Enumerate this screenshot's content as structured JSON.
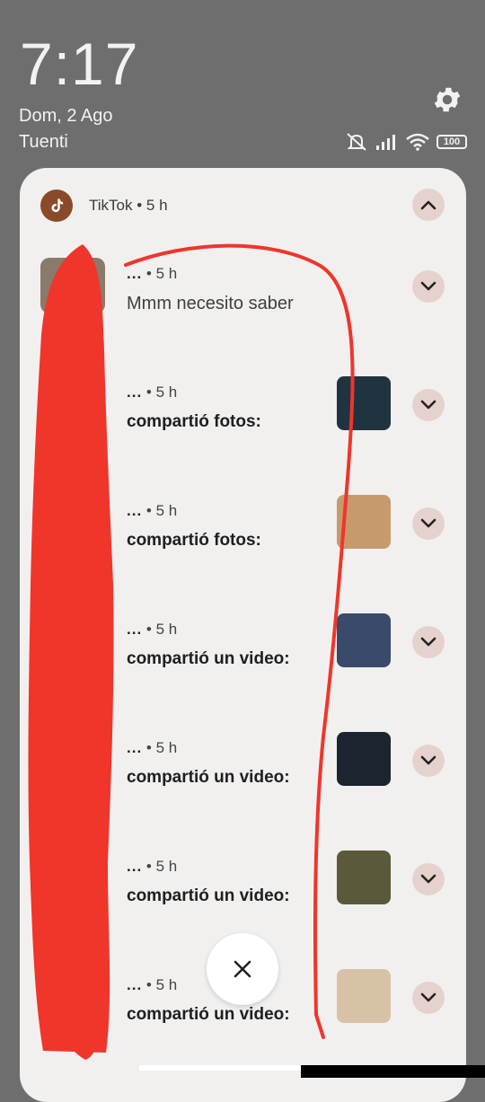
{
  "status_bar": {
    "time": "7:17",
    "date": "Dom, 2 Ago",
    "carrier": "Tuenti",
    "battery": "100",
    "icons": [
      "mute-icon",
      "signal-icon",
      "wifi-icon",
      "battery-icon",
      "settings-gear-icon"
    ]
  },
  "app": {
    "name": "TikTok",
    "time": "5 h",
    "separator": "•",
    "accent": "#8a4a2a"
  },
  "notifications": [
    {
      "sender": "...",
      "time": "5 h",
      "text": "Mmm necesito saber",
      "thumb": false
    },
    {
      "sender": "...",
      "time": "5 h",
      "text": "compartió fotos:",
      "thumb": true,
      "thumb_color": "#1f3340"
    },
    {
      "sender": "...",
      "time": "5 h",
      "text": "compartió fotos:",
      "thumb": true,
      "thumb_color": "#c79a6e"
    },
    {
      "sender": "...",
      "time": "5 h",
      "text": "compartió un video:",
      "thumb": true,
      "thumb_color": "#3a4a6a"
    },
    {
      "sender": "...",
      "time": "5 h",
      "text": "compartió un video:",
      "thumb": true,
      "thumb_color": "#1c2430"
    },
    {
      "sender": "...",
      "time": "5 h",
      "text": "compartió un video:",
      "thumb": true,
      "thumb_color": "#5a5a3a"
    },
    {
      "sender": "...",
      "time": "5 h",
      "text": "compartió un video:",
      "thumb": true,
      "thumb_color": "#d8c2a6"
    }
  ],
  "colors": {
    "panel_bg": "#f1f0ef",
    "button_bg": "#e5d2cd",
    "scribble": "#f0352b"
  }
}
